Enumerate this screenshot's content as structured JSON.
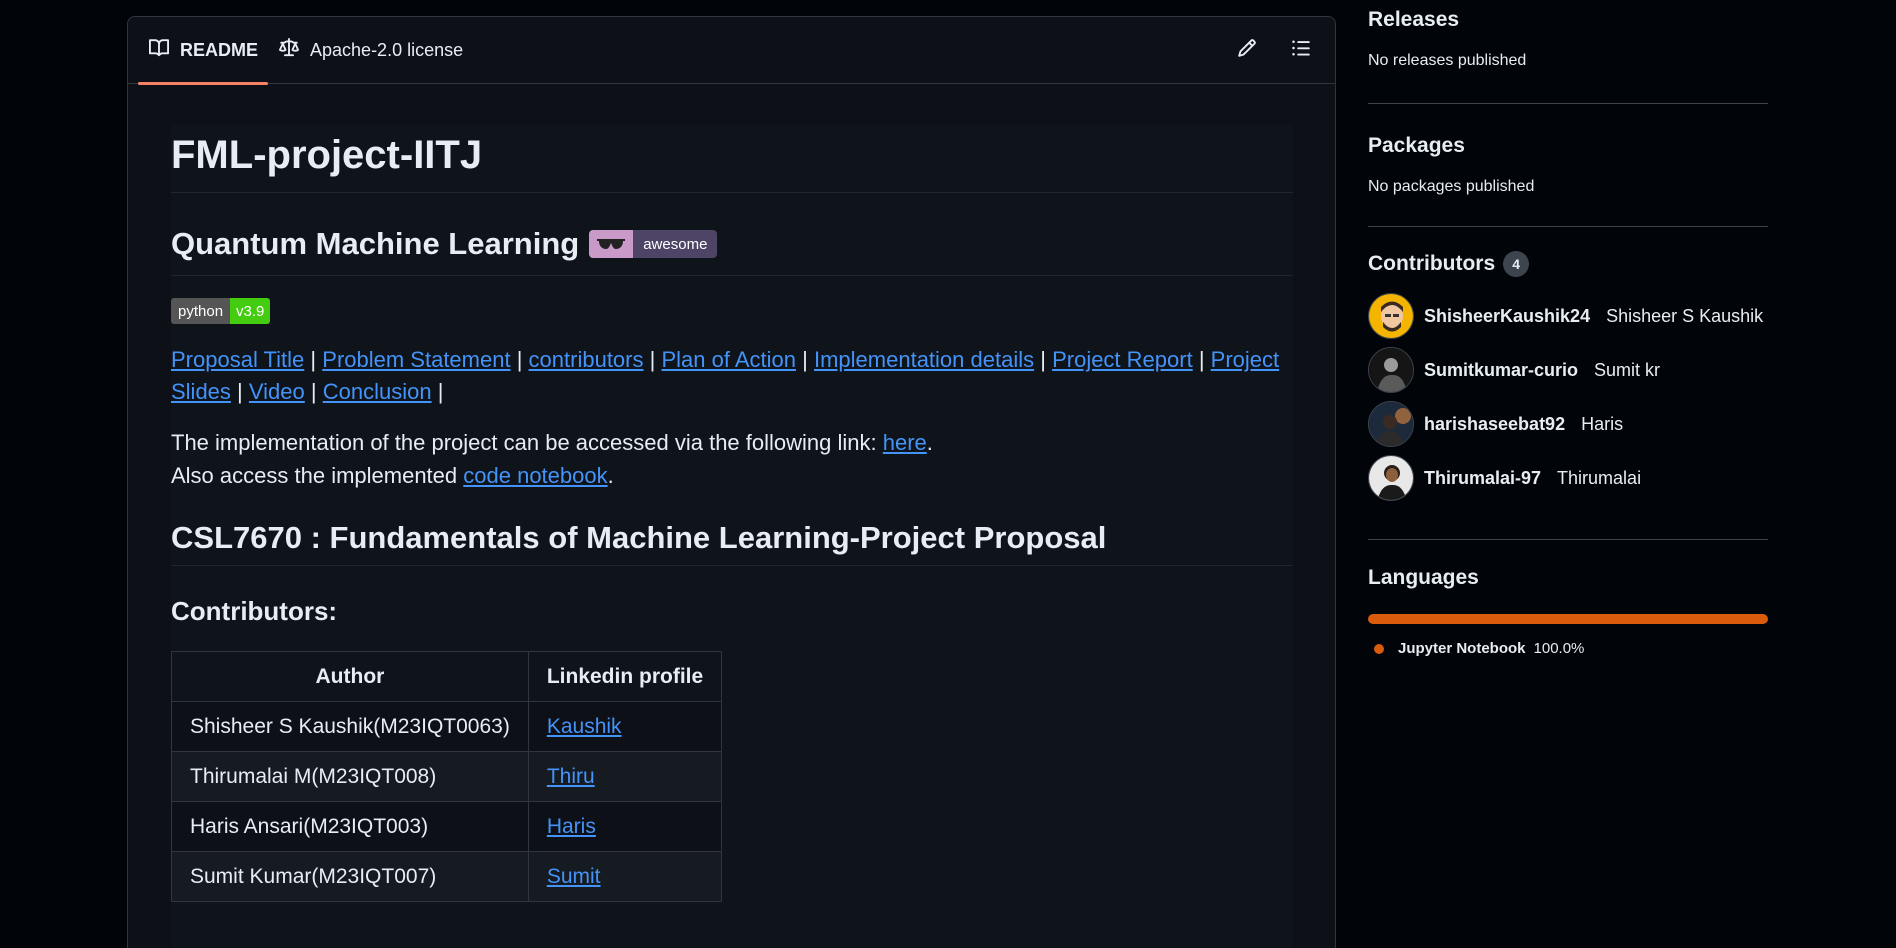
{
  "readme_tabs": {
    "readme_label": "README",
    "license_label": "Apache-2.0 license"
  },
  "readme": {
    "title": "FML-project-IITJ",
    "subtitle": "Quantum Machine Learning",
    "awesome_badge": "awesome",
    "python_badge": {
      "left": "python",
      "right": "v3.9"
    },
    "nav_links": [
      "Proposal Title",
      "Problem Statement",
      "contributors",
      "Plan of Action",
      "Implementation details",
      "Project Report",
      "Project Slides",
      "Video",
      "Conclusion"
    ],
    "nav_sep": "|",
    "impl_text": "The implementation of the project can be accessed via the following link: ",
    "impl_link": "here",
    "impl_end": ".",
    "notebook_text": "Also access the implemented ",
    "notebook_link": "code notebook",
    "notebook_end": ".",
    "heading_csl": "CSL7670 : Fundamentals of Machine Learning-Project Proposal",
    "contributors_heading": "Contributors:",
    "table": {
      "headers": [
        "Author",
        "Linkedin profile"
      ],
      "rows": [
        {
          "author": "Shisheer S Kaushik(M23IQT0063)",
          "link": "Kaushik"
        },
        {
          "author": "Thirumalai M(M23IQT008)",
          "link": "Thiru"
        },
        {
          "author": "Haris Ansari(M23IQT003)",
          "link": "Haris"
        },
        {
          "author": "Sumit Kumar(M23IQT007)",
          "link": "Sumit"
        }
      ]
    }
  },
  "sidebar": {
    "releases": {
      "title": "Releases",
      "text": "No releases published"
    },
    "packages": {
      "title": "Packages",
      "text": "No packages published"
    },
    "contributors": {
      "title": "Contributors",
      "count": "4",
      "people": [
        {
          "login": "ShisheerKaushik24",
          "name": "Shisheer S Kaushik"
        },
        {
          "login": "Sumitkumar-curio",
          "name": "Sumit kr"
        },
        {
          "login": "harishaseebat92",
          "name": "Haris"
        },
        {
          "login": "Thirumalai-97",
          "name": "Thirumalai"
        }
      ]
    },
    "languages": {
      "title": "Languages",
      "items": [
        {
          "name": "Jupyter Notebook",
          "percent": "100.0%",
          "color": "#da5b0b"
        }
      ]
    }
  },
  "colors": {
    "link": "#4493f8",
    "tab_underline": "#f78166",
    "jupyter": "#da5b0b"
  }
}
